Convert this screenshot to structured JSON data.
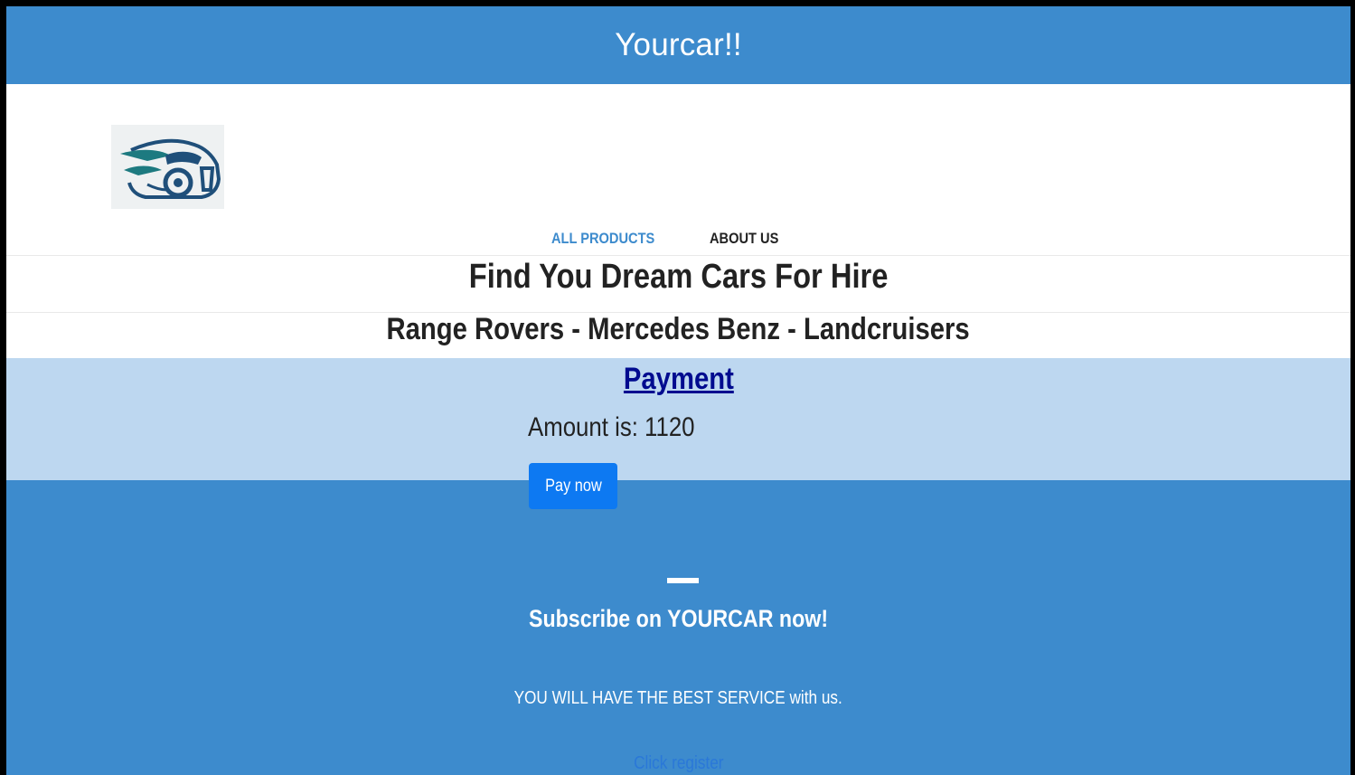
{
  "header": {
    "title": "Yourcar!!"
  },
  "nav": {
    "items": [
      {
        "label": "ALL PRODUCTS",
        "active": true
      },
      {
        "label": "ABOUT US",
        "active": false
      }
    ]
  },
  "hero": {
    "title": "Find You Dream Cars For Hire",
    "subtitle": "Range Rovers - Mercedes Benz - Landcruisers"
  },
  "payment": {
    "title": "Payment",
    "amount_text": "Amount is: 1120",
    "pay_button_label": "Pay now"
  },
  "footer": {
    "title": "Subscribe on YOURCAR now!",
    "text": "YOU WILL HAVE THE BEST SERVICE with us.",
    "link_label": "Click register"
  },
  "colors": {
    "brand_blue": "#3d8bcd",
    "payment_bg": "#bdd7f0",
    "button_blue": "#0d79f2",
    "link_dark_blue": "#000b8f"
  },
  "icons": {
    "logo": "sports-car-logo-icon"
  }
}
